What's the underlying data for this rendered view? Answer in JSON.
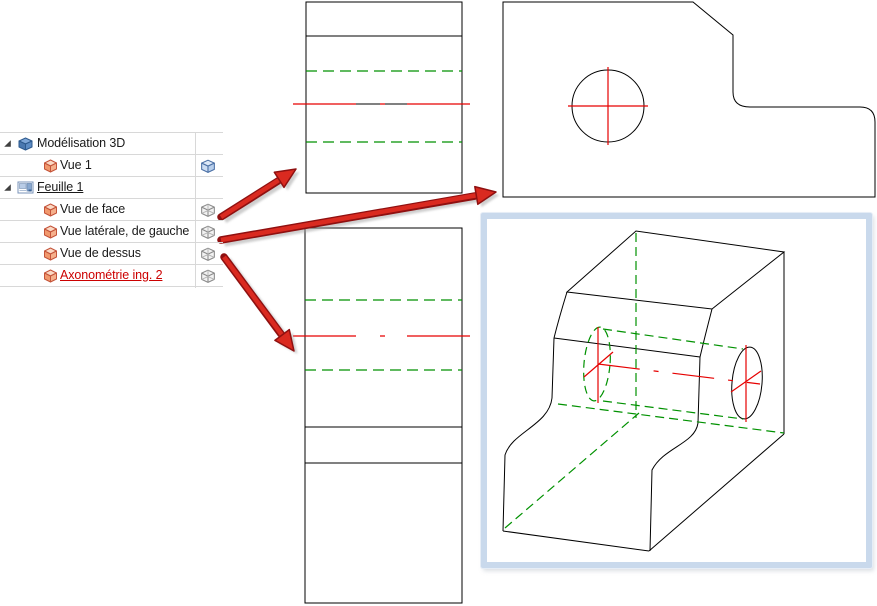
{
  "colors": {
    "line-black": "#000000",
    "line-green": "#009100",
    "line-red": "#e60000",
    "arrow-red": "#da2a20",
    "arrow-outline": "#8f1010",
    "selection-frame-blue": "#c9d9ec",
    "tree-grid": "#d8d8d8",
    "tree-text": "#1a1a1a",
    "active-item-red": "#cc0000"
  },
  "tree": {
    "rows": [
      {
        "label": "Modélisation 3D",
        "icon": "cube-3d-blue-icon",
        "expanded": true
      },
      {
        "label": "Vue 1",
        "icon": "view-cube-orange-icon",
        "right_icon": "cube-blue-glass-icon"
      },
      {
        "label": "Feuille 1",
        "icon": "sheet-icon",
        "expanded": true,
        "underlined": true
      },
      {
        "label": "Vue de face",
        "icon": "view-cube-orange-icon",
        "right_icon": "cube-wireframe-icon"
      },
      {
        "label": "Vue latérale, de gauche",
        "icon": "view-cube-orange-icon",
        "right_icon": "cube-wireframe-icon"
      },
      {
        "label": "Vue de dessus",
        "icon": "view-cube-orange-icon",
        "right_icon": "cube-wireframe-icon"
      },
      {
        "label": "Axonométrie ing. 2",
        "icon": "view-cube-orange-icon",
        "right_icon": "cube-wireframe-icon",
        "underlined": true,
        "highlighted_red": true
      }
    ]
  },
  "views": {
    "front_view": {
      "name": "Vue de face",
      "line_types": [
        "visible",
        "hidden-green",
        "centerline-red"
      ]
    },
    "side_view": {
      "name": "Vue latérale, de gauche",
      "features": [
        "hole-circle",
        "red-crosshair",
        "chamfer",
        "step-fillets"
      ]
    },
    "top_view": {
      "name": "Vue de dessus",
      "line_types": [
        "visible",
        "hidden-green",
        "centerline-red"
      ]
    },
    "iso_view": {
      "name": "Axonométrie ing. 2",
      "selected": true,
      "features": [
        "through-hole",
        "hidden-green-lines",
        "red-centerlines",
        "blue-selection-frame"
      ]
    }
  }
}
